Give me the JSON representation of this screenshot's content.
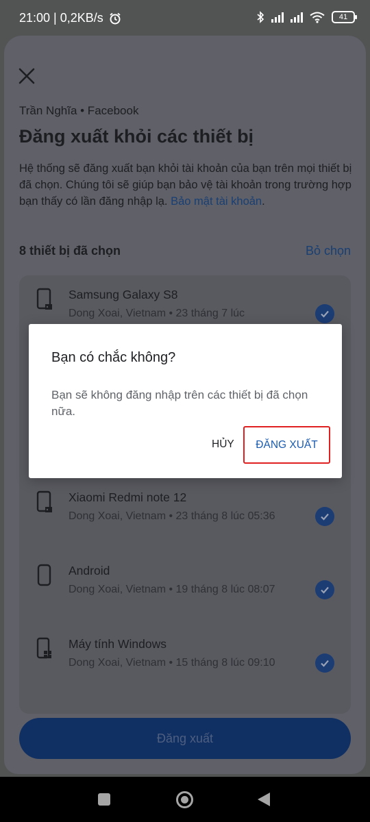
{
  "status_bar": {
    "time_speed": "21:00 | 0,2KB/s",
    "battery": "41",
    "icons": [
      "alarm-icon",
      "bluetooth-icon",
      "signal-icon",
      "signal-icon",
      "wifi-icon",
      "battery-icon"
    ]
  },
  "sheet": {
    "account_line": "Trần Nghĩa • Facebook",
    "title": "Đăng xuất khỏi các thiết bị",
    "description": "Hệ thống sẽ đăng xuất bạn khỏi tài khoản của bạn trên mọi thiết bị đã chọn. Chúng tôi sẽ giúp bạn bảo vệ tài khoản trong trường hợp bạn thấy có lần đăng nhập lạ. ",
    "description_link": "Bảo mật tài khoản",
    "description_end": ".",
    "selected_count": "8 thiết bị đã chọn",
    "deselect_label": "Bỏ chọn",
    "devices": [
      {
        "name": "Samsung Galaxy S8",
        "meta": "Dong Xoai, Vietnam • 23 tháng 7 lúc",
        "icon": "phone-icon"
      },
      {
        "name": "Xiaomi Redmi note 12",
        "meta": "Dong Xoai, Vietnam • 23 tháng 8 lúc 05:36",
        "icon": "phone-icon"
      },
      {
        "name": "Android",
        "meta": "Dong Xoai, Vietnam • 19 tháng 8 lúc 08:07",
        "icon": "android-phone-icon"
      },
      {
        "name": "Máy tính Windows",
        "meta": "Dong Xoai, Vietnam • 15 tháng 8 lúc 09:10",
        "icon": "windows-icon"
      }
    ],
    "logout_button": "Đăng xuất"
  },
  "dialog": {
    "title": "Bạn có chắc không?",
    "body": "Bạn sẽ không đăng nhập trên các thiết bị đã chọn nữa.",
    "cancel": "HỦY",
    "confirm": "ĐĂNG XUẤT",
    "highlight_color": "#e02020"
  },
  "colors": {
    "accent": "#1c3c74",
    "link": "#1a5bb0"
  }
}
